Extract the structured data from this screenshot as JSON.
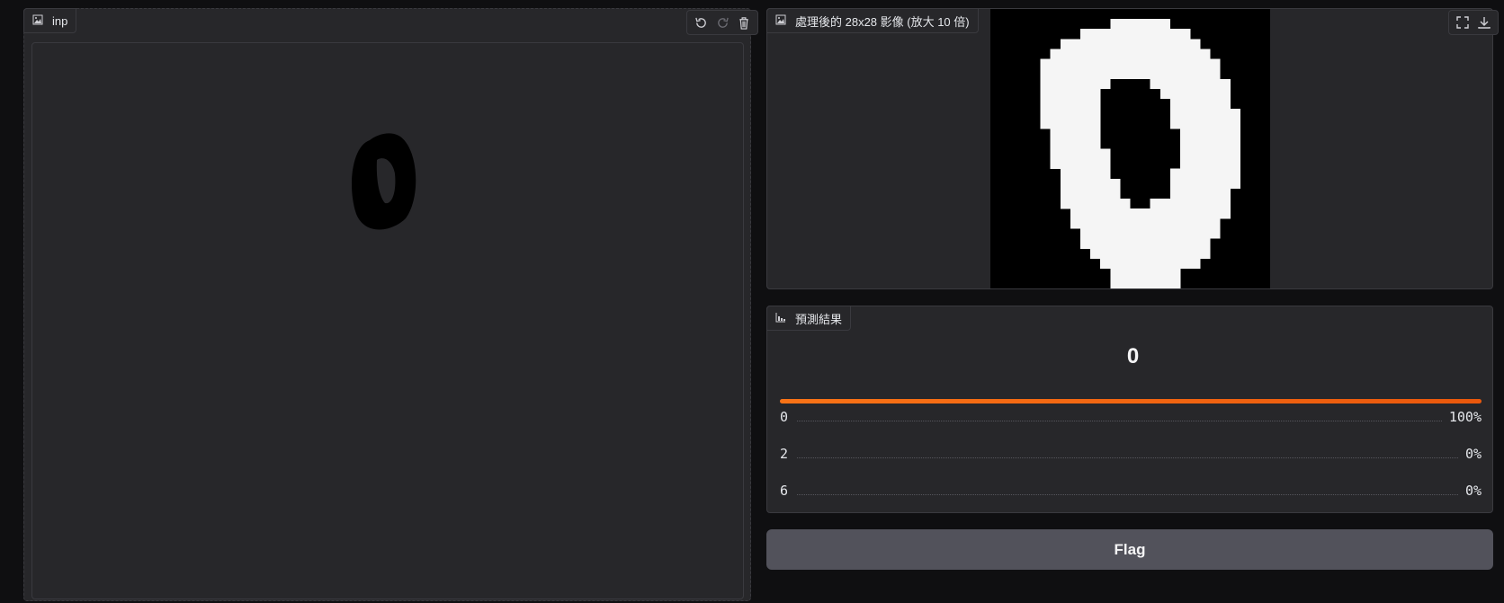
{
  "input_panel": {
    "label": "inp",
    "toolbar": {
      "undo": "undo-icon",
      "redo": "redo-icon",
      "clear": "trash-icon"
    }
  },
  "image_panel": {
    "label": "處理後的 28x28 影像 (放大 10 倍)",
    "toolbar": {
      "fullscreen": "fullscreen-icon",
      "download": "download-icon"
    },
    "pixels": [
      "0000000000000000000000000000",
      "0000000000001111110000000000",
      "0000000001111111111100000000",
      "0000000111111111111110000000",
      "0000001111111111111111000000",
      "0000011111111111111111100000",
      "0000011111111111111111100000",
      "0000011111110000111111110000",
      "0000011111100000011111110000",
      "0000011111100000001111110000",
      "0000011111100000001111111000",
      "0000011111100000001111111000",
      "0000001111100000000111111000",
      "0000001111100000000111111000",
      "0000001111110000000111111000",
      "0000001111110000000111111000",
      "0000000111110000001111111000",
      "0000000111111000001111111000",
      "0000000111111000001111110000",
      "0000000111111100111111110000",
      "0000000011111111111111110000",
      "0000000011111111111111100000",
      "0000000001111111111111100000",
      "0000000001111111111111000000",
      "0000000000111111111111000000",
      "0000000000011111111110000000",
      "0000000000001111111000000000",
      "0000000000001111111000000000"
    ]
  },
  "prediction_panel": {
    "label": "預測結果",
    "top_label": "0",
    "confidences": [
      {
        "label": "0",
        "value": "100%",
        "fraction": 1.0
      },
      {
        "label": "2",
        "value": "0%",
        "fraction": 0.0
      },
      {
        "label": "6",
        "value": "0%",
        "fraction": 0.0
      }
    ]
  },
  "flag_button": {
    "label": "Flag"
  },
  "colors": {
    "accent": "#f97316",
    "panel": "#27272a",
    "button": "#52525b"
  }
}
